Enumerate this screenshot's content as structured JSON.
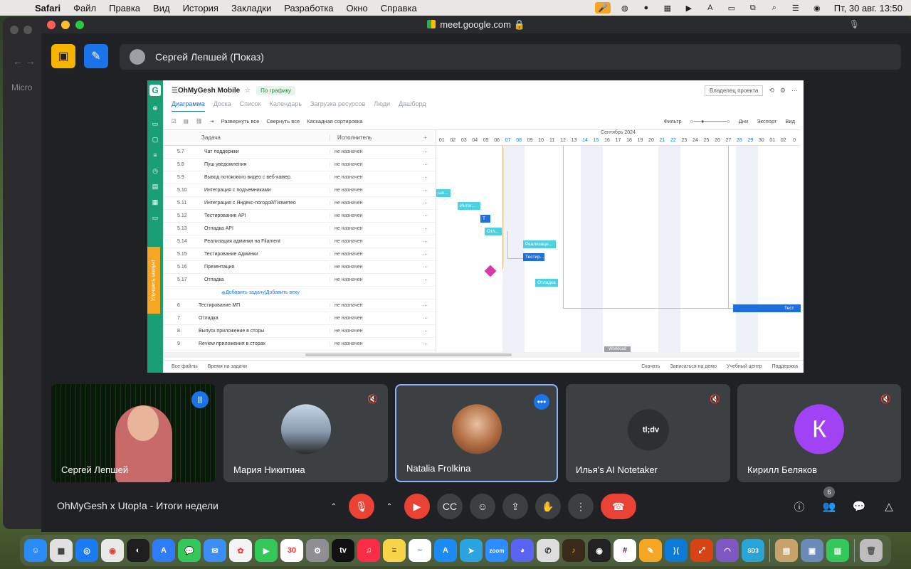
{
  "menubar": {
    "app": "Safari",
    "items": [
      "Файл",
      "Правка",
      "Вид",
      "История",
      "Закладки",
      "Разработка",
      "Окно",
      "Справка"
    ],
    "clock": "Пт, 30 авг.  13:50"
  },
  "browser": {
    "url": "meet.google.com",
    "back_tab": "Micro"
  },
  "meet": {
    "presenter": "Сергей Лепшей (Показ)",
    "meeting_title": "OhMyGesh x Utop!a - Итоги недели",
    "participants_count": "6",
    "participants": [
      {
        "name": "Сергей Лепшей"
      },
      {
        "name": "Мария Никитина"
      },
      {
        "name": "Natalia Frolkina"
      },
      {
        "name": "Илья's AI Notetaker",
        "logo": "tl;dv"
      },
      {
        "name": "Кирилл Беляков",
        "initial": "К"
      }
    ]
  },
  "app": {
    "project": "OhMyGesh Mobile",
    "schedule_badge": "По графику",
    "owner_btn": "Владелец проекта",
    "upgrade": "Улучшить аккаунт",
    "tabs": [
      "Диаграмма",
      "Доска",
      "Список",
      "Календарь",
      "Загрузка ресурсов",
      "Люди",
      "Дашборд"
    ],
    "toolbar": {
      "expand": "Развернуть все",
      "collapse": "Свернуть все",
      "sort": "Каскадная сортировка",
      "filter": "Фильтр",
      "days": "Дни",
      "export": "Экспорт",
      "view": "Вид"
    },
    "grid_head": {
      "task": "Задача",
      "assignee": "Исполнитель"
    },
    "rows": [
      {
        "num": "5.7",
        "name": "Чат поддержки",
        "assignee": "не назначен"
      },
      {
        "num": "5.8",
        "name": "Пуш уведомления",
        "assignee": "не назначен"
      },
      {
        "num": "5.9",
        "name": "Вывод потокового видео с веб-камер.",
        "assignee": "не назначен"
      },
      {
        "num": "5.10",
        "name": "Интеграция с подъемниками",
        "assignee": "не назначен"
      },
      {
        "num": "5.11",
        "name": "Интеграция с Яндекс-погодой/Гизметео",
        "assignee": "не назначен"
      },
      {
        "num": "5.12",
        "name": "Тестирование API",
        "assignee": "не назначен"
      },
      {
        "num": "5.13",
        "name": "Отладка API",
        "assignee": "не назначен"
      },
      {
        "num": "5.14",
        "name": "Реализация админки на Filament",
        "assignee": "не назначен"
      },
      {
        "num": "5.15",
        "name": "Тестирование Админки",
        "assignee": "не назначен"
      },
      {
        "num": "5.16",
        "name": "Презентация",
        "assignee": "не назначен"
      },
      {
        "num": "5.17",
        "name": "Отладка",
        "assignee": "не назначен"
      }
    ],
    "add_task": "Добавить задачу",
    "add_milestone": "Добавить веху",
    "top_rows": [
      {
        "num": "6",
        "name": "Тестирование МП",
        "assignee": "не назначен"
      },
      {
        "num": "7",
        "name": "Отладка",
        "assignee": "не назначен"
      },
      {
        "num": "8",
        "name": "Выпуск приложение в сторы",
        "assignee": "не назначен"
      },
      {
        "num": "9",
        "name": "Review приложения в сторах",
        "assignee": "не назначен"
      }
    ],
    "gantt": {
      "month": "Сентябрь 2024",
      "days": [
        "01",
        "02",
        "03",
        "04",
        "05",
        "06",
        "07",
        "08",
        "09",
        "10",
        "11",
        "12",
        "13",
        "14",
        "15",
        "16",
        "17",
        "18",
        "19",
        "20",
        "21",
        "22",
        "23",
        "24",
        "25",
        "26",
        "27",
        "28",
        "29",
        "30",
        "01",
        "02",
        "0"
      ],
      "bars": [
        "ые...",
        "Интег...",
        "Т",
        "Отл...",
        "Реализаци...",
        "Тестир...",
        "Отладка",
        "Тест"
      ],
      "workload": "Workload"
    },
    "status": {
      "files": "Все файлы",
      "time": "Время на задачи",
      "download": "Скачать",
      "demo": "Записаться на демо",
      "learn": "Учебный центр",
      "support": "Поддержка"
    }
  },
  "dock": {
    "calendar_day": "30",
    "zoom": "zoom"
  }
}
